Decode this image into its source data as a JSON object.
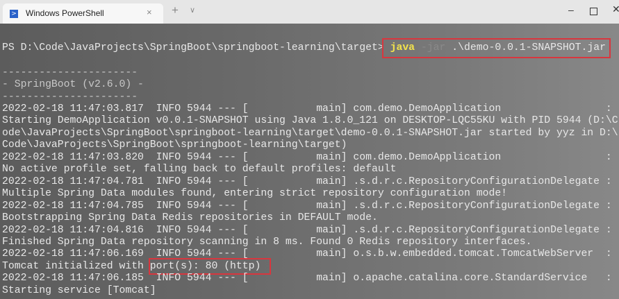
{
  "window": {
    "tab_title": "Windows PowerShell",
    "tab_icon": "powershell-icon",
    "close_tab": "×",
    "new_tab": "+",
    "dropdown": "∨",
    "minimize": "–",
    "close": "✕"
  },
  "prompt": {
    "path": "PS D:\\Code\\JavaProjects\\SpringBoot\\springboot-learning\\target> ",
    "cmd": "java",
    "arg": " -jar",
    "file": " .\\demo-0.0.1-SNAPSHOT.jar"
  },
  "banner": [
    "----------------------",
    "- SpringBoot (v2.6.0) -",
    "----------------------"
  ],
  "log_lines": [
    "2022-02-18 11:47:03.817  INFO 5944 --- [           main] com.demo.DemoApplication                 :",
    "Starting DemoApplication v0.0.1-SNAPSHOT using Java 1.8.0_121 on DESKTOP-LQC55KU with PID 5944 (D:\\C",
    "ode\\JavaProjects\\SpringBoot\\springboot-learning\\target\\demo-0.0.1-SNAPSHOT.jar started by yyz in D:\\",
    "Code\\JavaProjects\\SpringBoot\\springboot-learning\\target)",
    "2022-02-18 11:47:03.820  INFO 5944 --- [           main] com.demo.DemoApplication                 :",
    "No active profile set, falling back to default profiles: default",
    "2022-02-18 11:47:04.781  INFO 5944 --- [           main] .s.d.r.c.RepositoryConfigurationDelegate :",
    "Multiple Spring Data modules found, entering strict repository configuration mode!",
    "2022-02-18 11:47:04.785  INFO 5944 --- [           main] .s.d.r.c.RepositoryConfigurationDelegate :",
    "Bootstrapping Spring Data Redis repositories in DEFAULT mode.",
    "2022-02-18 11:47:04.816  INFO 5944 --- [           main] .s.d.r.c.RepositoryConfigurationDelegate :",
    "Finished Spring Data repository scanning in 8 ms. Found 0 Redis repository interfaces.",
    "2022-02-18 11:47:06.169  INFO 5944 --- [           main] o.s.b.w.embedded.tomcat.TomcatWebServer  :",
    "Tomcat initialized with port(s): 80 (http)",
    "2022-02-18 11:47:06.185  INFO 5944 --- [           main] o.apache.catalina.core.StandardService   :",
    "Starting service [Tomcat]"
  ],
  "highlight_color": "#d9363e"
}
